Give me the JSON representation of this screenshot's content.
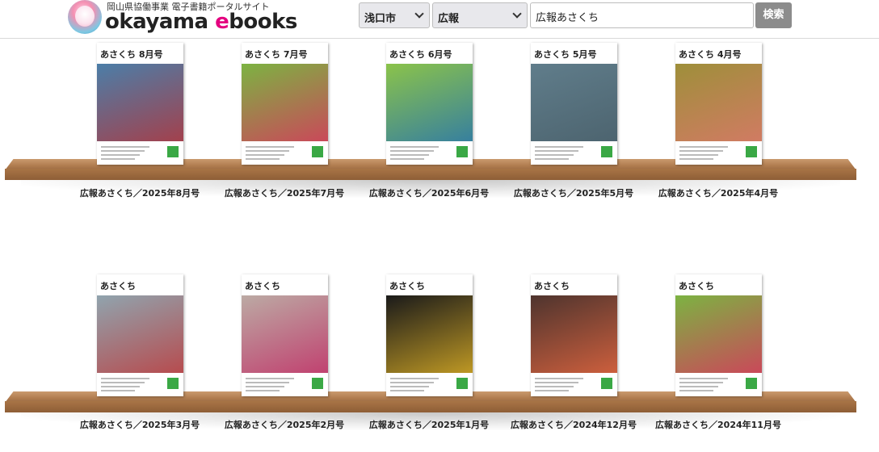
{
  "header": {
    "logo_sub": "岡山県協働事業 電子書籍ポータルサイト",
    "logo_main_a": "o",
    "logo_main_b": "kayama ",
    "logo_main_c": "e",
    "logo_main_d": "books",
    "city_select": "浅口市",
    "category_select": "広報",
    "search_value": "広報あさくち",
    "search_button": "検索"
  },
  "shelves": [
    {
      "books": [
        {
          "cover_title": "あさくち 8月号",
          "label": "広報あさくち／2025年8月号",
          "theme": "#4b7ea8",
          "accent": "#c62828"
        },
        {
          "cover_title": "あさくち 7月号",
          "label": "広報あさくち／2025年7月号",
          "theme": "#7cb342",
          "accent": "#e91e63"
        },
        {
          "cover_title": "あさくち 6月号",
          "label": "広報あさくち／2025年6月号",
          "theme": "#8bc34a",
          "accent": "#1565c0"
        },
        {
          "cover_title": "あさくち 5月号",
          "label": "広報あさくち／2025年5月号",
          "theme": "#607d8b",
          "accent": "#455a64"
        },
        {
          "cover_title": "あさくち 4月号",
          "label": "広報あさくち／2025年4月号",
          "theme": "#9e8f3a",
          "accent": "#e57373"
        }
      ]
    },
    {
      "books": [
        {
          "cover_title": "あさくち",
          "label": "広報あさくち／2025年3月号",
          "theme": "#90a4ae",
          "accent": "#c62828"
        },
        {
          "cover_title": "あさくち",
          "label": "広報あさくち／2025年2月号",
          "theme": "#bcaaa4",
          "accent": "#c2185b"
        },
        {
          "cover_title": "あさくち",
          "label": "広報あさくち／2025年1月号",
          "theme": "#1a1a1a",
          "accent": "#ffca28"
        },
        {
          "cover_title": "あさくち",
          "label": "広報あさくち／2024年12月号",
          "theme": "#4e342e",
          "accent": "#ff7043"
        },
        {
          "cover_title": "あさくち",
          "label": "広報あさくち／2024年11月号",
          "theme": "#7cb342",
          "accent": "#e91e63"
        }
      ]
    }
  ]
}
